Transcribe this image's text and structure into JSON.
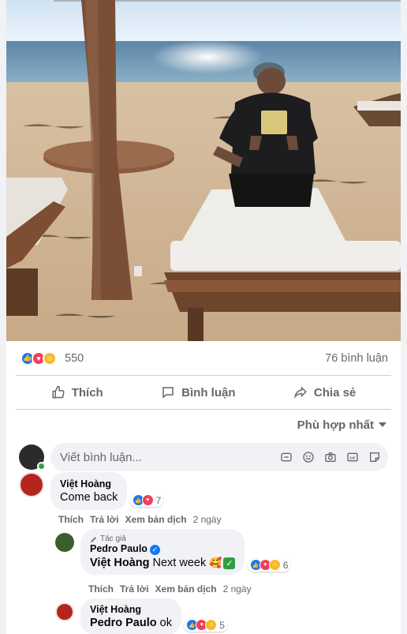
{
  "stats": {
    "reaction_count": "550",
    "comment_count": "76 bình luận"
  },
  "actions": {
    "like": "Thích",
    "comment": "Bình luận",
    "share": "Chia sẻ"
  },
  "sort": {
    "label": "Phù hợp nhất"
  },
  "composer": {
    "placeholder": "Viết bình luận..."
  },
  "comments": [
    {
      "name": "Việt Hoàng",
      "text": "Come back",
      "reactions": "7",
      "meta": {
        "like": "Thích",
        "reply": "Trả lời",
        "translate": "Xem bản dịch",
        "time": "2 ngày"
      }
    },
    {
      "author_badge": "Tác giả",
      "name": "Pedro Paulo",
      "tag": "Việt Hoàng",
      "text": "Next week",
      "reactions": "6",
      "meta": {
        "like": "Thích",
        "reply": "Trả lời",
        "translate": "Xem bản dịch",
        "time": "2 ngày"
      }
    },
    {
      "name": "Việt Hoàng",
      "tag": "Pedro Paulo",
      "text": "ok",
      "reactions": "5"
    }
  ],
  "colors": {
    "accent": "#1877f2",
    "love": "#f33e58",
    "care": "#f7b928",
    "online": "#31a24c"
  }
}
